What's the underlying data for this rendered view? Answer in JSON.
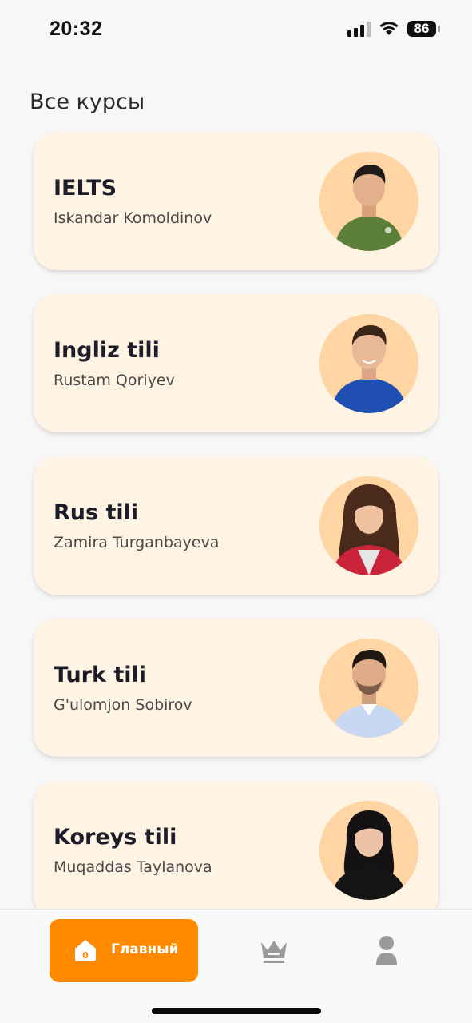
{
  "status_bar": {
    "time": "20:32",
    "battery": "86",
    "icons": [
      "cellular-signal-icon",
      "wifi-icon",
      "battery-icon"
    ]
  },
  "page": {
    "title": "Все курсы"
  },
  "courses": [
    {
      "title": "IELTS",
      "teacher": "Iskandar Komoldinov",
      "avatar": "teacher-photo-green-shirt"
    },
    {
      "title": "Ingliz tili",
      "teacher": "Rustam Qoriyev",
      "avatar": "teacher-photo-blue-sweater"
    },
    {
      "title": "Rus tili",
      "teacher": "Zamira Turganbayeva",
      "avatar": "teacher-photo-red-jacket"
    },
    {
      "title": "Turk tili",
      "teacher": "G'ulomjon Sobirov",
      "avatar": "teacher-photo-light-shirt"
    },
    {
      "title": "Koreys tili",
      "teacher": "Muqaddas Taylanova",
      "avatar": "teacher-photo-black-top"
    }
  ],
  "bottom_nav": {
    "home_label": "Главный",
    "home_badge": "0",
    "items": [
      "home-icon",
      "crown-icon",
      "profile-icon"
    ]
  },
  "colors": {
    "accent": "#ff8a00",
    "card_background": "#fff3e3",
    "avatar_background": "#fed5a3",
    "page_background": "#f7f7f7"
  }
}
